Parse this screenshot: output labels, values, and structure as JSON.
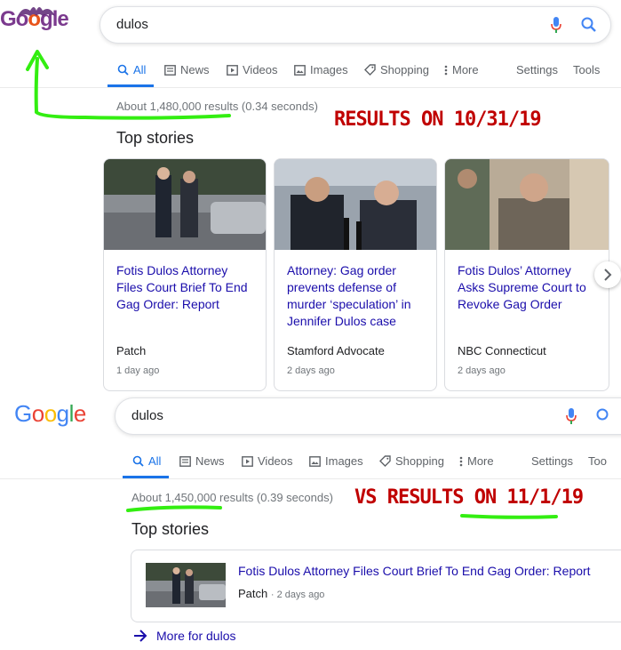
{
  "top": {
    "logo_letters": [
      "G",
      "o",
      "o",
      "g",
      "l",
      "e"
    ],
    "query": "dulos",
    "tabs": [
      {
        "label": "All",
        "icon": "search-icon"
      },
      {
        "label": "News",
        "icon": "newspaper-icon"
      },
      {
        "label": "Videos",
        "icon": "play-icon"
      },
      {
        "label": "Images",
        "icon": "image-icon"
      },
      {
        "label": "Shopping",
        "icon": "tag-icon"
      },
      {
        "label": "More",
        "icon": "more-vertical-icon"
      }
    ],
    "settings": "Settings",
    "tools": "Tools",
    "stats": "About 1,480,000 results (0.34 seconds)",
    "annotation": "RESULTS ON 10/31/19",
    "top_stories": "Top stories",
    "cards": [
      {
        "headline": "Fotis Dulos Attorney Files Court Brief To End Gag Order: Report",
        "source": "Patch",
        "age": "1 day ago"
      },
      {
        "headline": "Attorney: Gag order prevents defense of murder ‘speculation’ in Jennifer Dulos case",
        "source": "Stamford Advocate",
        "age": "2 days ago"
      },
      {
        "headline": "Fotis Dulos’ Attorney Asks Supreme Court to Revoke Gag Order",
        "source": "NBC Connecticut",
        "age": "2 days ago"
      }
    ]
  },
  "bottom": {
    "logo_letters": [
      "G",
      "o",
      "o",
      "g",
      "l",
      "e"
    ],
    "query": "dulos",
    "tabs": [
      {
        "label": "All",
        "icon": "search-icon"
      },
      {
        "label": "News",
        "icon": "newspaper-icon"
      },
      {
        "label": "Videos",
        "icon": "play-icon"
      },
      {
        "label": "Images",
        "icon": "image-icon"
      },
      {
        "label": "Shopping",
        "icon": "tag-icon"
      },
      {
        "label": "More",
        "icon": "more-vertical-icon"
      }
    ],
    "settings": "Settings",
    "tools": "Too",
    "stats": "About 1,450,000 results (0.39 seconds)",
    "annotation": "VS RESULTS ON 11/1/19",
    "top_stories": "Top stories",
    "story": {
      "headline": "Fotis Dulos Attorney Files Court Brief To End Gag Order: Report",
      "source": "Patch",
      "age": "2 days ago"
    },
    "more_link": "More for dulos"
  },
  "colors": {
    "google_blue": "#4285f4",
    "google_red": "#ea4335",
    "google_yellow": "#fbbc05",
    "google_green": "#34a853",
    "annotation_red": "#c00000",
    "highlight_green": "#33ee11",
    "link_blue": "#1a0dab",
    "halloween_purple": "#7b3a8e"
  }
}
